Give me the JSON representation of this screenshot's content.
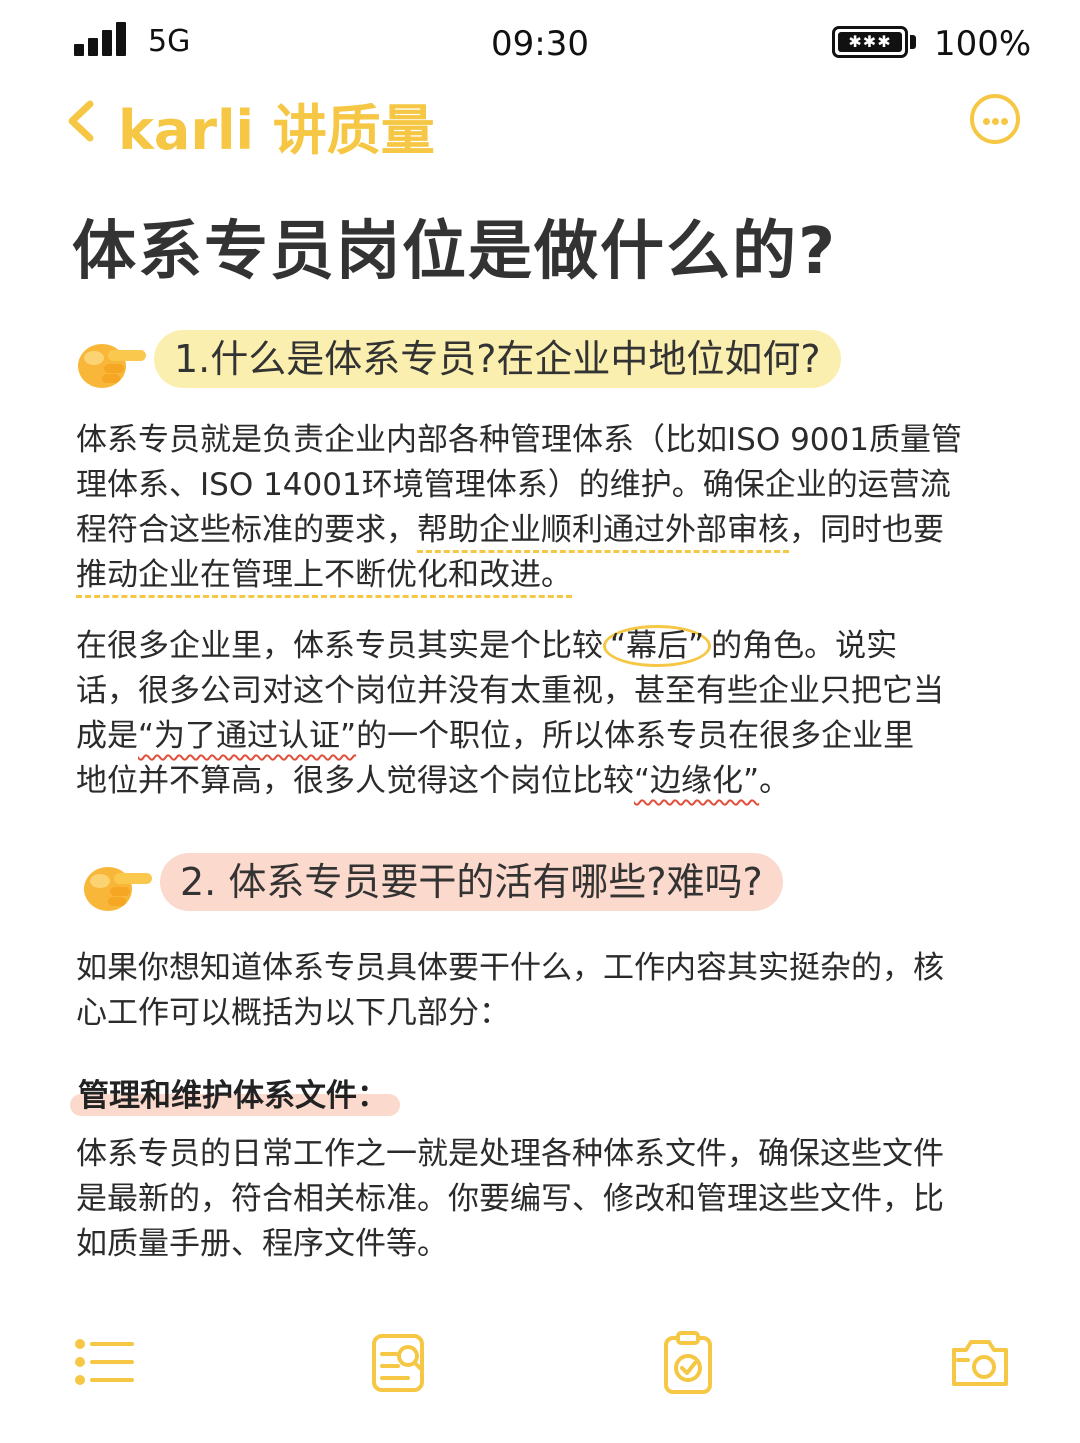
{
  "status_bar": {
    "network": "5G",
    "time": "09:30",
    "battery_glyph": "✱✱✱",
    "battery_percent": "100%"
  },
  "nav": {
    "title": "karli 讲质量",
    "accent_color": "#f6c744"
  },
  "page_title": "体系专员岗位是做什么的?",
  "section1": {
    "heading": "1.什么是体系专员?在企业中地位如何?",
    "pill_color": "#fbefb0",
    "p1": {
      "line1": "体系专员就是负责企业内部各种管理体系（比如ISO 9001质量管",
      "line2": "理体系、ISO 14001环境管理体系）的维护。确保企业的运营流",
      "line3a": "程符合这些标准的要求，",
      "line3b": "帮助企业顺利通过外部审核",
      "line3c": "，同时也要",
      "line4": "推动企业在管理上不断优化和改进。"
    },
    "p2": {
      "line1a": "在很多企业里，体系专员其实是个比较",
      "line1b": "“幕后”",
      "line1c": "的角色。说实",
      "line2": "话，很多公司对这个岗位并没有太重视，甚至有些企业只把它当",
      "line3a": "成是",
      "line3b": "“为了通过认证”",
      "line3c": "的一个职位，所以体系专员在很多企业里",
      "line4a": "地位并不算高，很多人觉得这个岗位比较",
      "line4b": "“边缘化”",
      "line4c": "。"
    }
  },
  "section2": {
    "heading": "2. 体系专员要干的活有哪些?难吗?",
    "pill_color": "#fbd9cc",
    "intro": {
      "line1": "如果你想知道体系专员具体要干什么，工作内容其实挺杂的，核",
      "line2": "心工作可以概括为以下几部分："
    },
    "subheading": "管理和维护体系文件：",
    "body": {
      "line1": "体系专员的日常工作之一就是处理各种体系文件，确保这些文件",
      "line2": "是最新的，符合相关标准。你要编写、修改和管理这些文件，比",
      "line3": "如质量手册、程序文件等。"
    }
  },
  "toolbar": {
    "icons": [
      "list-icon",
      "checklist-search-icon",
      "clipboard-check-icon",
      "camera-icon"
    ]
  }
}
